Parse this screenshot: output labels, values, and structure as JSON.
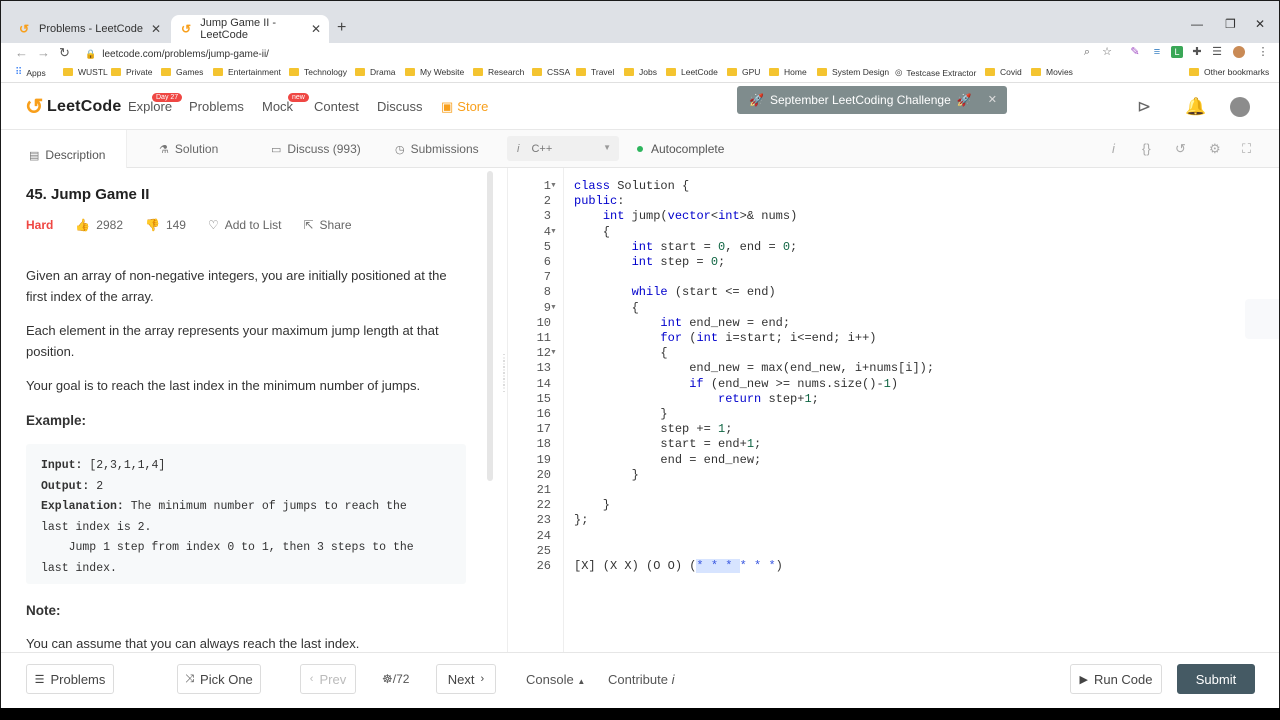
{
  "browser": {
    "tabs": [
      {
        "label": "Problems - LeetCode"
      },
      {
        "label": "Jump Game II - LeetCode"
      }
    ],
    "url": "leetcode.com/problems/jump-game-ii/",
    "bookmarks": [
      "Apps",
      "WUSTL",
      "Private",
      "Games",
      "Entertainment",
      "Technology",
      "Drama",
      "My Website",
      "Research",
      "CSSA",
      "Travel",
      "Jobs",
      "LeetCode",
      "GPU",
      "Home",
      "System Design",
      "Testcase Extractor",
      "Covid",
      "Movies"
    ],
    "other_bookmarks": "Other bookmarks"
  },
  "header": {
    "logo_text": "LeetCode",
    "nav": [
      {
        "label": "Explore",
        "badge": "Day 27"
      },
      {
        "label": "Problems"
      },
      {
        "label": "Mock",
        "badge": "new"
      },
      {
        "label": "Contest"
      },
      {
        "label": "Discuss"
      },
      {
        "label": "Store"
      }
    ],
    "challenge_banner": "September LeetCoding Challenge",
    "colors": {
      "accent": "#f89f1b",
      "badge_day": "#ef4743",
      "badge_new": "#ef4743"
    }
  },
  "left_tabs": [
    {
      "label": "Description"
    },
    {
      "label": "Solution"
    },
    {
      "label": "Discuss (993)"
    },
    {
      "label": "Submissions"
    }
  ],
  "problem": {
    "title": "45. Jump Game II",
    "difficulty": "Hard",
    "likes": "2982",
    "dislikes": "149",
    "add_to_list": "Add to List",
    "share": "Share",
    "para1": "Given an array of non-negative integers, you are initially positioned at the first index of the array.",
    "para2": "Each element in the array represents your maximum jump length at that position.",
    "para3": "Your goal is to reach the last index in the minimum number of jumps.",
    "example_heading": "Example:",
    "example": {
      "input_label": "Input:",
      "input_value": "[2,3,1,1,4]",
      "output_label": "Output:",
      "output_value": "2",
      "explanation_label": "Explanation:",
      "explanation_line1": "The minimum number of jumps to reach the",
      "explanation_line2": "last index is 2.",
      "explanation_line3": "    Jump 1 step from index 0 to 1, then 3 steps to the",
      "explanation_line4": "last index."
    },
    "note_heading": "Note:",
    "note": "You can assume that you can always reach the last index."
  },
  "editor_toolbar": {
    "language": "C++",
    "autocomplete": "Autocomplete"
  },
  "code_lines": [
    "class Solution {",
    "public:",
    "    int jump(vector<int>& nums)",
    "    {",
    "        int start = 0, end = 0;",
    "        int step = 0;",
    "",
    "        while (start <= end)",
    "        {",
    "            int end_new = end;",
    "            for (int i=start; i<=end; i++)",
    "            {",
    "                end_new = max(end_new, i+nums[i]);",
    "                if (end_new >= nums.size()-1)",
    "                    return step+1;",
    "            }",
    "            step += 1;",
    "            start = end+1;",
    "            end = end_new;",
    "        }",
    "",
    "    }",
    "};",
    "",
    "",
    "[X] (X X) (O O) (* * * * * *)"
  ],
  "bottom": {
    "problems": "Problems",
    "pick_one": "Pick One",
    "prev": "Prev",
    "page": "/72",
    "next": "Next",
    "console": "Console",
    "contribute": "Contribute",
    "run_code": "Run Code",
    "submit": "Submit"
  }
}
